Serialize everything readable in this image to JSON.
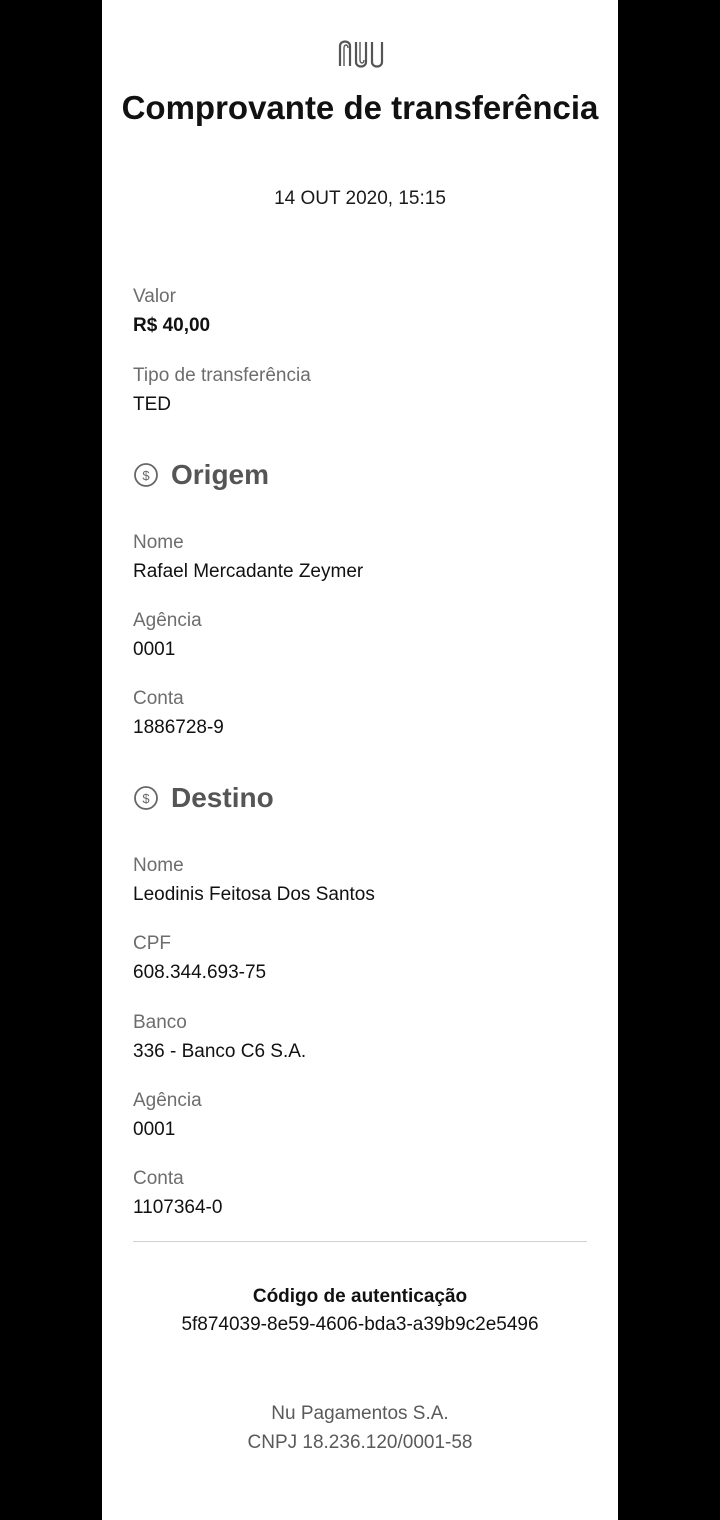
{
  "receipt": {
    "logo_icon": "nubank-logo-icon",
    "title": "Comprovante de transferência",
    "datetime": "14 OUT 2020, 15:15",
    "valor": {
      "label": "Valor",
      "value": "R$ 40,00"
    },
    "tipo": {
      "label": "Tipo de transferência",
      "value": "TED"
    },
    "origem": {
      "icon": "money-circle-icon",
      "title": "Origem",
      "nome": {
        "label": "Nome",
        "value": "Rafael Mercadante Zeymer"
      },
      "agencia": {
        "label": "Agência",
        "value": "0001"
      },
      "conta": {
        "label": "Conta",
        "value": "1886728-9"
      }
    },
    "destino": {
      "icon": "money-circle-icon",
      "title": "Destino",
      "nome": {
        "label": "Nome",
        "value": "Leodinis Feitosa Dos Santos"
      },
      "cpf": {
        "label": "CPF",
        "value": "608.344.693-75"
      },
      "banco": {
        "label": "Banco",
        "value": "336 - Banco C6 S.A."
      },
      "agencia": {
        "label": "Agência",
        "value": "0001"
      },
      "conta": {
        "label": "Conta",
        "value": "1107364-0"
      }
    },
    "auth": {
      "title": "Código de autenticação",
      "code": "5f874039-8e59-4606-bda3-a39b9c2e5496"
    },
    "footer": {
      "company": "Nu Pagamentos S.A.",
      "cnpj": "CNPJ 18.236.120/0001-58"
    }
  }
}
